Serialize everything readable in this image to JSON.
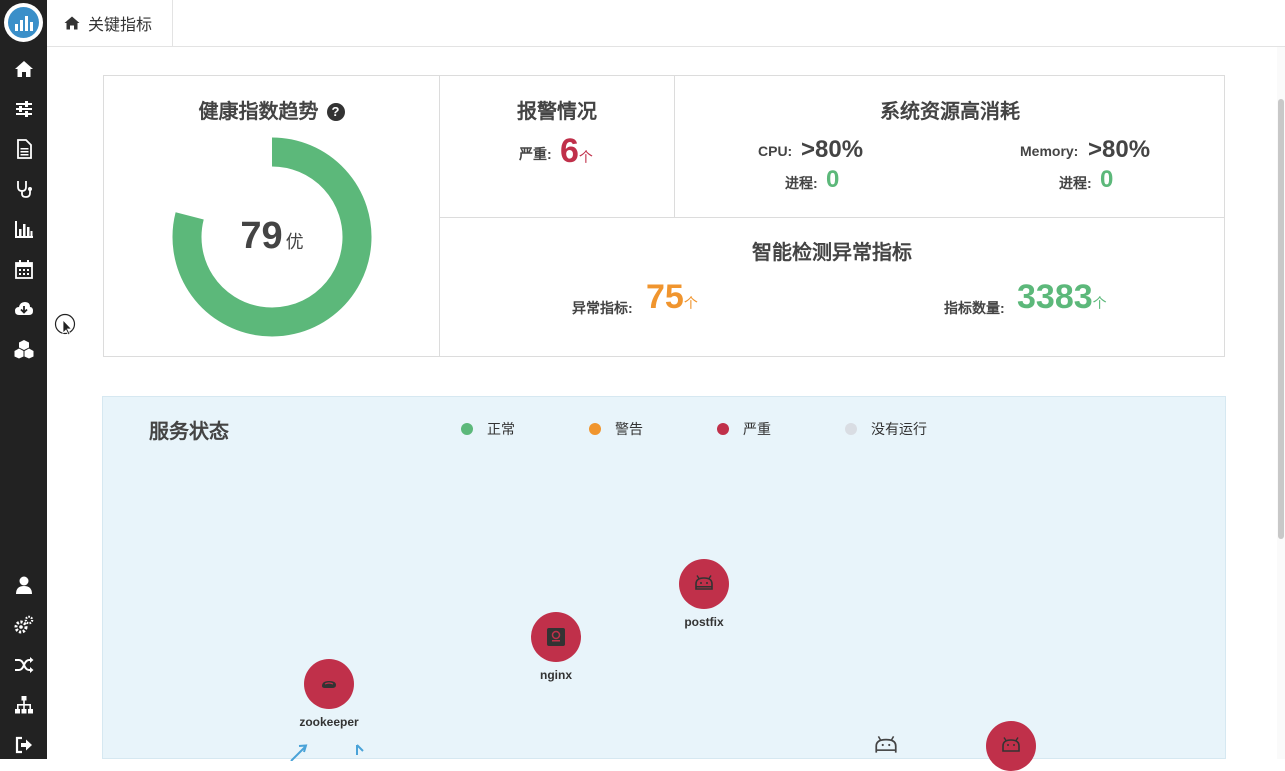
{
  "breadcrumb": {
    "label": "关键指标"
  },
  "health": {
    "title": "健康指数趋势",
    "help": "?",
    "score": "79",
    "grade": "优",
    "score_fraction": 0.79,
    "color": "#5cb87a"
  },
  "alarm": {
    "title": "报警情况",
    "severe_label": "严重:",
    "severe_count": "6",
    "unit": "个"
  },
  "resources": {
    "title": "系统资源高消耗",
    "cpu_label": "CPU:",
    "cpu_value": ">80%",
    "cpu_proc_label": "进程:",
    "cpu_proc_value": "0",
    "mem_label": "Memory:",
    "mem_value": ">80%",
    "mem_proc_label": "进程:",
    "mem_proc_value": "0"
  },
  "anomaly": {
    "title": "智能检测异常指标",
    "abnormal_label": "异常指标:",
    "abnormal_value": "75",
    "unit": "个",
    "metric_count_label": "指标数量:",
    "metric_count_value": "3383"
  },
  "service_status": {
    "title": "服务状态",
    "legend": [
      {
        "label": "正常",
        "color": "#5cb87a"
      },
      {
        "label": "警告",
        "color": "#f0952e"
      },
      {
        "label": "严重",
        "color": "#c0304a"
      },
      {
        "label": "没有运行",
        "color": "#d9dde3"
      }
    ],
    "services": [
      {
        "name": "postfix",
        "status": "严重",
        "icon": "android-icon"
      },
      {
        "name": "nginx",
        "status": "严重",
        "icon": "server-icon"
      },
      {
        "name": "zookeeper",
        "status": "严重",
        "icon": "zookeeper-icon"
      }
    ]
  },
  "colors": {
    "sidebar": "#222222",
    "critical": "#c0304a",
    "warning": "#f0952e",
    "normal": "#5cb87a",
    "status_bg": "#e8f4fa"
  },
  "sidebar_icons": [
    "home-icon",
    "sliders-icon",
    "document-icon",
    "stethoscope-icon",
    "bar-chart-icon",
    "calendar-icon",
    "cloud-download-icon",
    "cubes-icon",
    "user-icon",
    "gears-icon",
    "shuffle-icon",
    "sitemap-icon",
    "sign-out-icon"
  ]
}
